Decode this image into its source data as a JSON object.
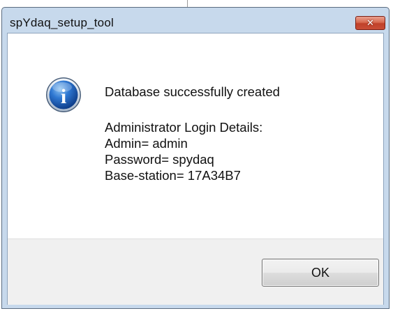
{
  "window": {
    "title": "spYdaq_setup_tool",
    "close_glyph": "✕"
  },
  "icon": {
    "name": "info-icon",
    "glyph": "i"
  },
  "message": {
    "line1": "Database successfully created",
    "line2": "Administrator Login Details:",
    "line3": "Admin= admin",
    "line4": "Password= spydaq",
    "line5": "Base-station= 17A34B7"
  },
  "buttons": {
    "ok_label": "OK"
  },
  "colors": {
    "titlebar": "#c7d9ec",
    "close_button": "#c94d36",
    "info_icon": "#1d5fb8",
    "button_area": "#f0f0f0"
  }
}
